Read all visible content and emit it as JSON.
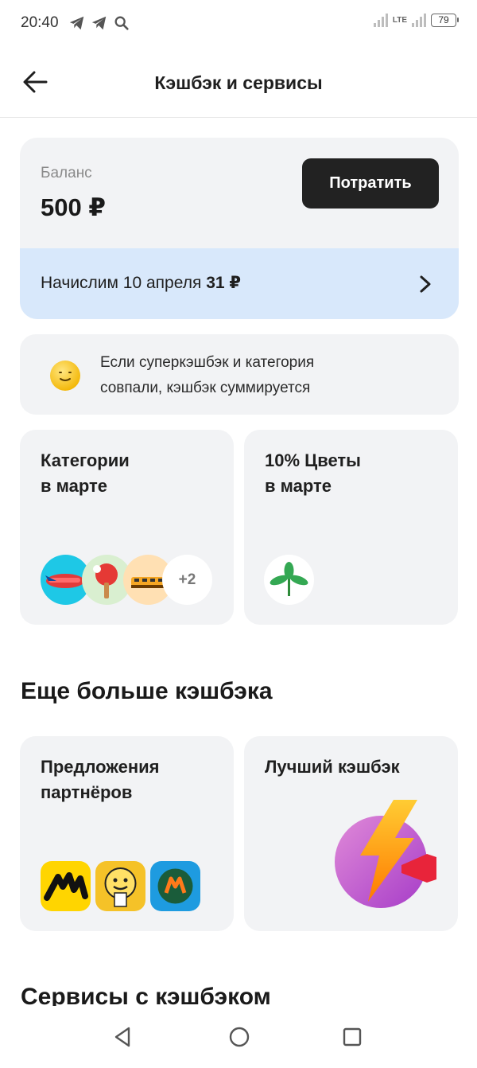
{
  "status": {
    "time": "20:40",
    "network": "LTE",
    "battery": "79"
  },
  "header": {
    "title": "Кэшбэк и сервисы"
  },
  "balance": {
    "label": "Баланс",
    "value": "500 ₽",
    "spend_label": "Потратить",
    "accrual_prefix": "Начислим 10 апреля ",
    "accrual_amount": "31 ₽"
  },
  "info": {
    "line1": "Если суперкэшбэк и категория",
    "line2": "совпали, кэшбэк суммируется"
  },
  "categories_card": {
    "title_line1": "Категории",
    "title_line2": "в марте",
    "more": "+2"
  },
  "flowers_card": {
    "title_line1": "10% Цветы",
    "title_line2": "в марте"
  },
  "more_cashback": {
    "title": "Еще больше кэшбэка"
  },
  "partners_card": {
    "title_line1": "Предложения",
    "title_line2": "партнёров"
  },
  "best_card": {
    "title": "Лучший кэшбэк"
  },
  "services": {
    "title": "Сервисы с кэшбэком"
  },
  "colors": {
    "accent_dark": "#222222",
    "accrual_bg": "#d8e8fb",
    "card_bg": "#f2f3f5"
  }
}
